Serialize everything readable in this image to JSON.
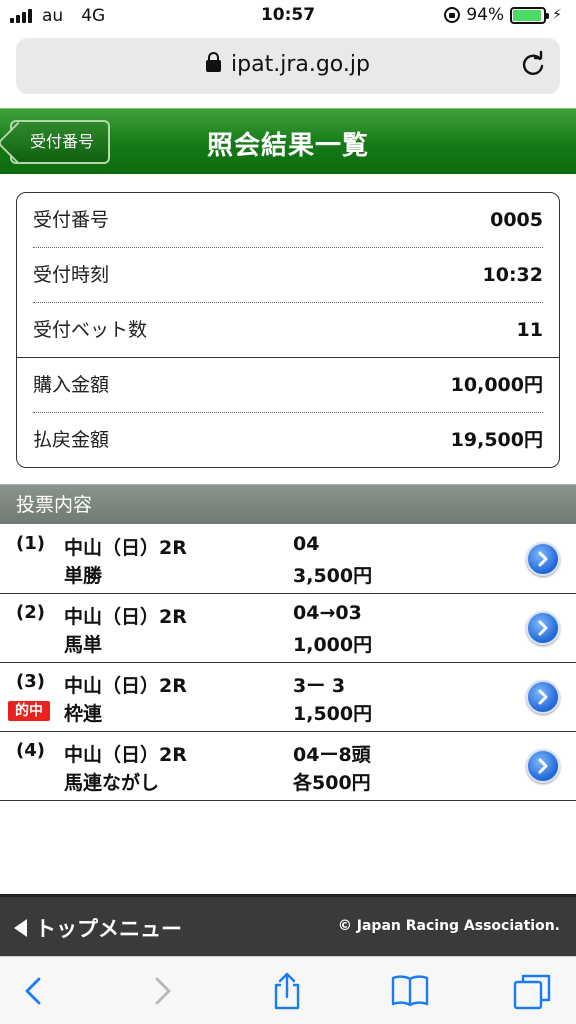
{
  "status_bar": {
    "carrier": "au",
    "network": "4G",
    "time": "10:57",
    "battery": "94%"
  },
  "browser": {
    "url": "ipat.jra.go.jp"
  },
  "header": {
    "back_label": "受付番号",
    "title": "照会結果一覧"
  },
  "summary": [
    {
      "label": "受付番号",
      "value": "0005"
    },
    {
      "label": "受付時刻",
      "value": "10:32"
    },
    {
      "label": "受付ベット数",
      "value": "11"
    },
    {
      "label": "購入金額",
      "value": "10,000円"
    },
    {
      "label": "払戻金額",
      "value": "19,500円"
    }
  ],
  "section": {
    "title": "投票内容"
  },
  "bets": [
    {
      "num": "(1)",
      "venue": "中山（日）2R",
      "type": "単勝",
      "combo": "04",
      "amount": "3,500円",
      "hit": ""
    },
    {
      "num": "(2)",
      "venue": "中山（日）2R",
      "type": "馬単",
      "combo": "04→03",
      "amount": "1,000円",
      "hit": ""
    },
    {
      "num": "(3)",
      "venue": "中山（日）2R",
      "type": "枠連",
      "combo": "3ー 3",
      "amount": "1,500円",
      "hit": "的中"
    },
    {
      "num": "(4)",
      "venue": "中山（日）2R",
      "type": "馬連ながし",
      "combo": "04ー8頭",
      "amount": "各500円",
      "hit": ""
    }
  ],
  "footer": {
    "top_menu": "トップメニュー",
    "copyright": "© Japan Racing Association."
  },
  "colors": {
    "header_green": "#157a16",
    "hit_red": "#e8231d",
    "chevron_blue": "#1f66d6",
    "battery_green": "#4cd964"
  },
  "icons": [
    "back-arrow-icon",
    "forward-arrow-icon",
    "share-icon",
    "bookmarks-icon",
    "tabs-icon",
    "reload-icon",
    "lock-icon",
    "chevron-right-icon"
  ],
  "battery_level": 0.94
}
